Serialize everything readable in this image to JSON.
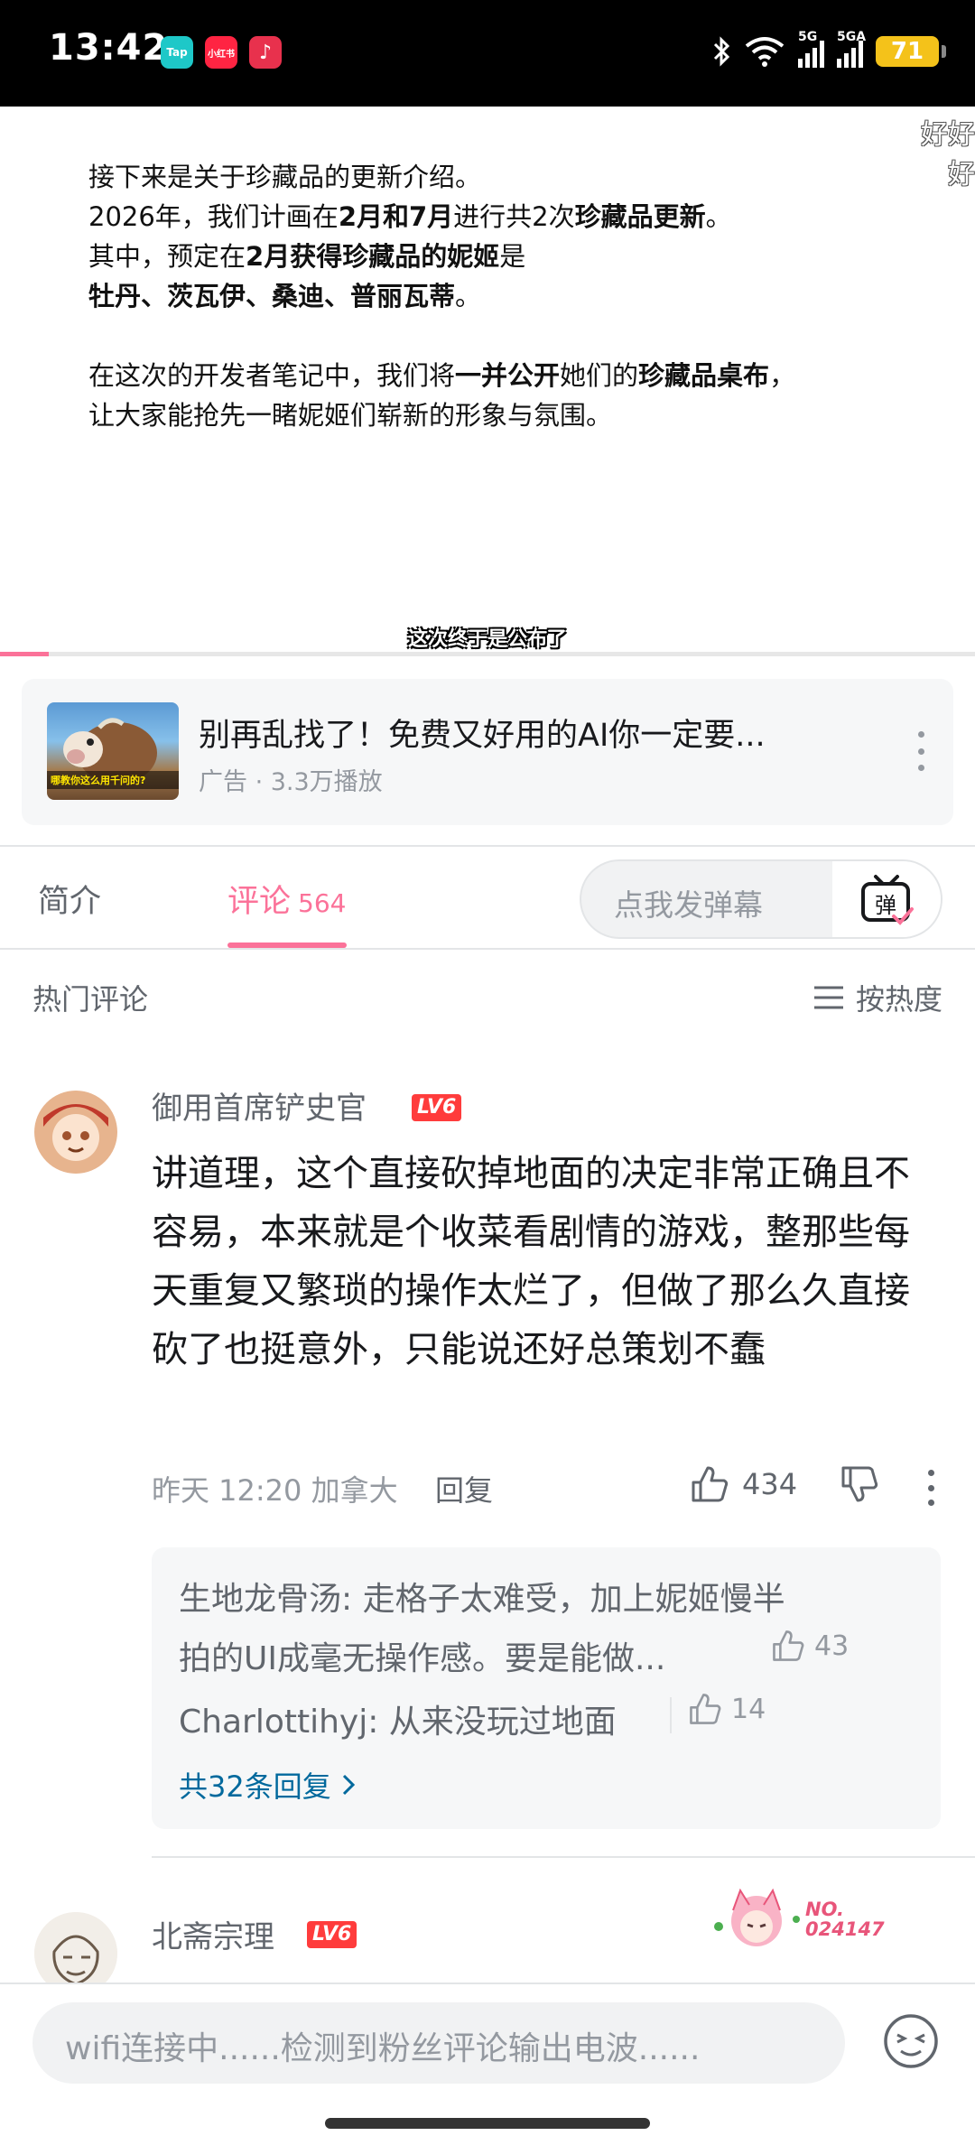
{
  "status_bar": {
    "time": "13:42",
    "app_icons": [
      "Tap",
      "小红书",
      "♪"
    ],
    "network": [
      "5G",
      "5GA"
    ],
    "battery": "71"
  },
  "video": {
    "lines": [
      [
        {
          "t": "接下来是关于珍藏品的更新介绍。",
          "b": false
        }
      ],
      [
        {
          "t": "2026年，我们计画在",
          "b": false
        },
        {
          "t": "2月和7月",
          "b": true
        },
        {
          "t": "进行共2次",
          "b": false
        },
        {
          "t": "珍藏品更新",
          "b": true
        },
        {
          "t": "。",
          "b": false
        }
      ],
      [
        {
          "t": "其中，预定在",
          "b": false
        },
        {
          "t": "2月获得珍藏品的妮姬",
          "b": true
        },
        {
          "t": "是",
          "b": false
        }
      ],
      [
        {
          "t": "牡丹、茨瓦伊、桑迪、普丽瓦蒂",
          "b": true
        },
        {
          "t": "。",
          "b": false
        }
      ],
      [],
      [
        {
          "t": "在这次的开发者笔记中，我们将",
          "b": false
        },
        {
          "t": "一并公开",
          "b": true
        },
        {
          "t": "她们的",
          "b": false
        },
        {
          "t": "珍藏品桌布",
          "b": true
        },
        {
          "t": "，",
          "b": false
        }
      ],
      [
        {
          "t": "让大家能抢先一睹妮姬们崭新的形象与氛围。",
          "b": false
        }
      ]
    ],
    "subtitle": "这次终于是公布了",
    "corner_danmaku": [
      "好好",
      "好"
    ],
    "progress": 0.05
  },
  "ad": {
    "title": "别再乱找了！免费又好用的AI你一定要...",
    "meta": "广告 · 3.3万播放",
    "thumb_caption": "哪教你这么用千问的?"
  },
  "tabs": {
    "intro": "简介",
    "comments": "评论",
    "comment_count": "564",
    "danmaku_placeholder": "点我发弹幕",
    "danmaku_btn": "弹"
  },
  "comments_header": {
    "title": "热门评论",
    "sort": "按热度"
  },
  "comment1": {
    "username": "御用首席铲史官",
    "level": "LV6",
    "text": "讲道理，这个直接砍掉地面的决定非常正确且不容易，本来就是个收菜看剧情的游戏，整那些每天重复又繁琐的操作太烂了，但做了那么久直接砍了也挺意外，只能说还好总策划不蠢",
    "meta": "昨天 12:20 加拿大",
    "reply_label": "回复",
    "likes": "434",
    "replies": [
      {
        "author": "生地龙骨汤",
        "text_line1": "生地龙骨汤: 走格子太难受，加上妮姬慢半",
        "text_line2": "拍的UI成毫无操作感。要是能做...",
        "likes": "43"
      },
      {
        "author": "Charlottihyj",
        "text_line1": "Charlottihyj: 从来没玩过地面",
        "likes": "14"
      }
    ],
    "view_all": "共32条回复"
  },
  "comment2": {
    "username": "北斋宗理",
    "level": "LV6",
    "fan_no": [
      "NO.",
      "024147"
    ]
  },
  "input": {
    "placeholder": "wifi连接中......检测到粉丝评论输出电波......"
  },
  "colors": {
    "accent": "#fb7299",
    "link": "#00699d",
    "muted": "#9499a0",
    "level_red": "#ff3c3c"
  }
}
